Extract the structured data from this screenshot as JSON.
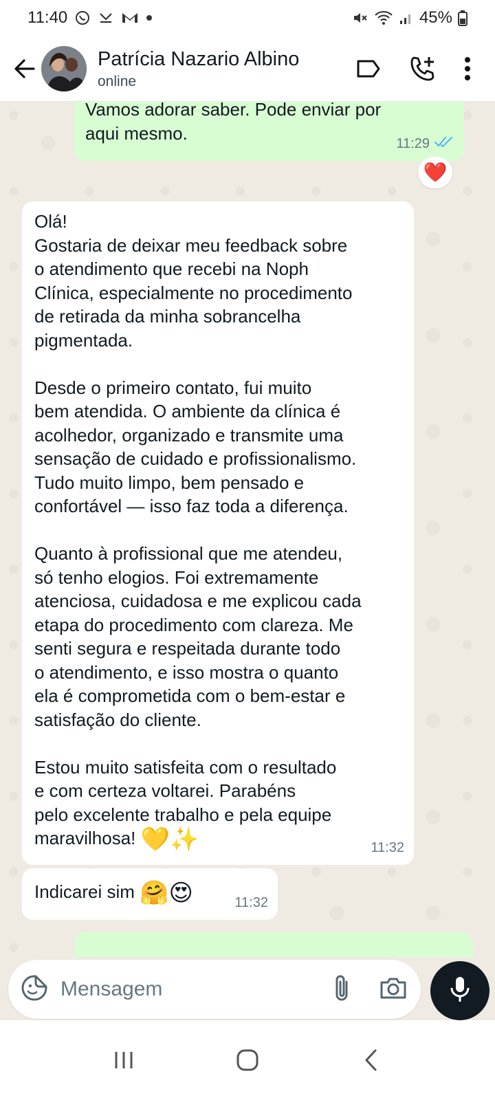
{
  "status_bar": {
    "time": "11:40",
    "battery": "45%"
  },
  "header": {
    "contact_name": "Patrícia Nazario Albino",
    "contact_status": "online"
  },
  "messages": [
    {
      "direction": "outgoing",
      "text": "Vamos adorar saber. Pode enviar por\naqui mesmo.",
      "time": "11:29",
      "reaction": "❤️"
    },
    {
      "direction": "incoming",
      "text": "Olá!\nGostaria de deixar meu feedback sobre\no atendimento que recebi na Noph\nClínica, especialmente no procedimento\nde retirada da minha sobrancelha\npigmentada.\n\nDesde o primeiro contato, fui muito\nbem atendida. O ambiente da clínica é\nacolhedor, organizado e transmite uma\nsensação de cuidado e profissionalismo.\nTudo muito limpo, bem pensado e\nconfortável — isso faz toda a diferença.\n\nQuanto à profissional que me atendeu,\nsó tenho elogios. Foi extremamente\natenciosa, cuidadosa e me explicou cada\netapa do procedimento com clareza. Me\nsenti segura e respeitada durante todo\no atendimento, e isso mostra o quanto\nela é comprometida com o bem-estar e\nsatisfação do cliente.\n\nEstou muito satisfeita com o resultado\ne com certeza voltarei. Parabéns\npelo excelente trabalho e pela equipe\nmaravilhosa!",
      "emoji": "💛✨",
      "time": "11:32"
    },
    {
      "direction": "incoming",
      "text": "Indicarei sim",
      "emoji": "🤗😍",
      "time": "11:32"
    }
  ],
  "input": {
    "placeholder": "Mensagem"
  }
}
